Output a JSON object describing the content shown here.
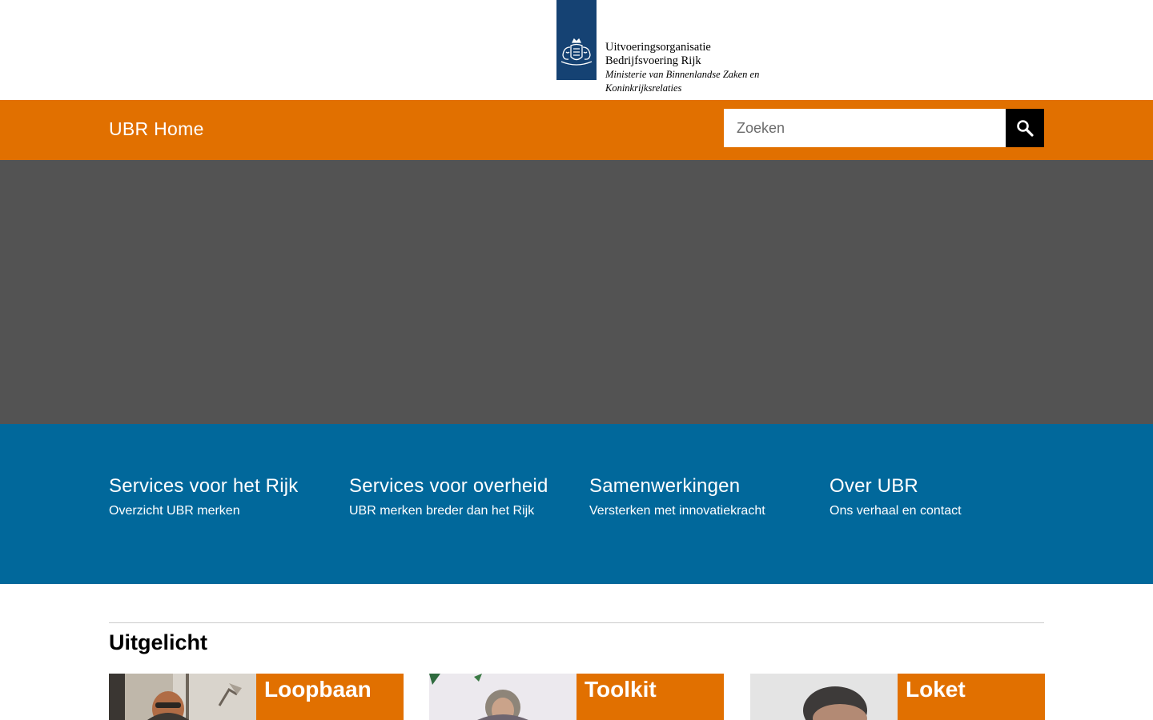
{
  "logo": {
    "line1": "Uitvoeringsorganisatie",
    "line2": "Bedrijfsvoering Rijk",
    "line3": "Ministerie van Binnenlandse Zaken en",
    "line4": "Koninkrijksrelaties",
    "flag_color": "#154273",
    "icon": "coat-of-arms-icon"
  },
  "nav": {
    "home_label": "UBR Home",
    "search_placeholder": "Zoeken",
    "search_icon": "search-icon",
    "bar_color": "#e17000"
  },
  "hero": {
    "background": "#535353"
  },
  "band": {
    "background": "#01689b",
    "columns": [
      {
        "title": "Services voor het Rijk",
        "subtitle": "Overzicht UBR merken"
      },
      {
        "title": "Services voor overheid",
        "subtitle": "UBR merken breder dan het Rijk"
      },
      {
        "title": "Samenwerkingen",
        "subtitle": "Versterken met innovatiekracht"
      },
      {
        "title": "Over UBR",
        "subtitle": "Ons verhaal en contact"
      }
    ]
  },
  "featured": {
    "title": "Uitgelicht",
    "cards": [
      {
        "label": "Loopbaan"
      },
      {
        "label": "Toolkit"
      },
      {
        "label": "Loket"
      }
    ]
  }
}
